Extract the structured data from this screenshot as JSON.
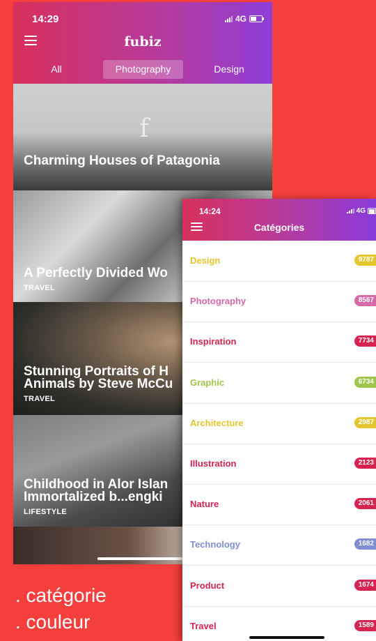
{
  "feed_screen": {
    "status": {
      "time": "14:29",
      "network": "4G"
    },
    "header": {
      "logo": "fubiz"
    },
    "tabs": [
      {
        "label": "All",
        "active": false
      },
      {
        "label": "Photography",
        "active": true
      },
      {
        "label": "Design",
        "active": false
      }
    ],
    "articles": [
      {
        "title": "Charming Houses of Patagonia",
        "category": ""
      },
      {
        "title": "A Perfectly Divided Wo",
        "category": "TRAVEL"
      },
      {
        "title_line1": "Stunning Portraits of H",
        "title_line2": "Animals by Steve McCu",
        "category": "TRAVEL"
      },
      {
        "title_line1": "Childhood in Alor Islan",
        "title_line2": "Immortalized b...engki",
        "category": "LIFESTYLE"
      }
    ]
  },
  "caption": {
    "line1": ". catégorie",
    "line2": ". couleur"
  },
  "categories_screen": {
    "status": {
      "time": "14:24",
      "network": "4G"
    },
    "title": "Catégories",
    "items": [
      {
        "label": "Design",
        "count": "9787",
        "color": "#e6c62f"
      },
      {
        "label": "Photography",
        "count": "8567",
        "color": "#d76aa6"
      },
      {
        "label": "Inspiration",
        "count": "7734",
        "color": "#d6234f"
      },
      {
        "label": "Graphic",
        "count": "6734",
        "color": "#9ec64a"
      },
      {
        "label": "Architecture",
        "count": "2987",
        "color": "#e6c62f"
      },
      {
        "label": "Illustration",
        "count": "2123",
        "color": "#d6234f"
      },
      {
        "label": "Nature",
        "count": "2061",
        "color": "#d6234f"
      },
      {
        "label": "Technology",
        "count": "1682",
        "color": "#7f8ed3"
      },
      {
        "label": "Product",
        "count": "1674",
        "color": "#d6234f"
      },
      {
        "label": "Travel",
        "count": "1589",
        "color": "#d6234f"
      }
    ]
  },
  "colors": {
    "background": "#f53f3d",
    "gradient_start": "#d8305c",
    "gradient_end": "#8e3ed8"
  }
}
